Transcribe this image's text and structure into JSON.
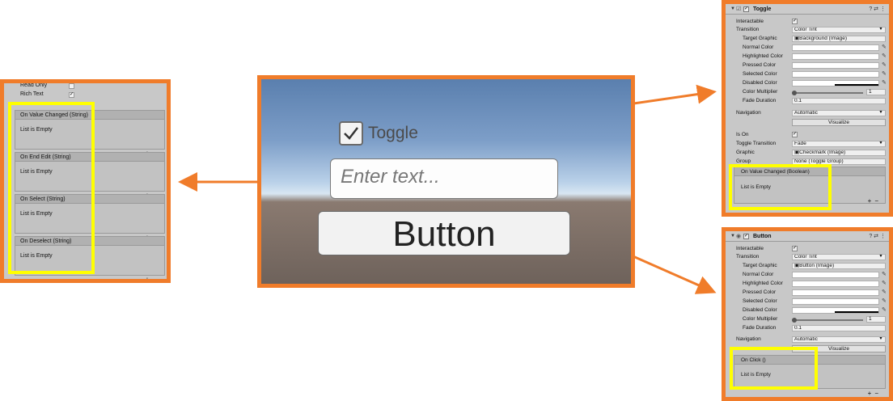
{
  "colors": {
    "accent_frame": "#f07c2a",
    "highlight": "#ffff00",
    "panel_bg": "#c8c8c8"
  },
  "left_panel": {
    "partial_rows": [
      {
        "label": "Read Only",
        "checked": false
      },
      {
        "label": "Rich Text",
        "checked": true
      }
    ],
    "events": [
      {
        "title": "On Value Changed (String)",
        "body": "List is Empty"
      },
      {
        "title": "On End Edit (String)",
        "body": "List is Empty"
      },
      {
        "title": "On Select (String)",
        "body": "List is Empty"
      },
      {
        "title": "On Deselect (String)",
        "body": "List is Empty"
      }
    ],
    "plus": "+",
    "minus": "−"
  },
  "scene": {
    "toggle_label": "Toggle",
    "toggle_checked": true,
    "input_placeholder": "Enter text...",
    "button_label": "Button"
  },
  "toggle_inspector": {
    "title": "Toggle",
    "header_icons": "? ⇄ ⋮",
    "interactable_label": "Interactable",
    "transition_label": "Transition",
    "transition_value": "Color Tint",
    "target_graphic_label": "Target Graphic",
    "target_graphic_value": "Background (Image)",
    "normal_color_label": "Normal Color",
    "highlighted_color_label": "Highlighted Color",
    "pressed_color_label": "Pressed Color",
    "selected_color_label": "Selected Color",
    "disabled_color_label": "Disabled Color",
    "color_multiplier_label": "Color Multiplier",
    "color_multiplier_value": "1",
    "fade_duration_label": "Fade Duration",
    "fade_duration_value": "0.1",
    "navigation_label": "Navigation",
    "navigation_value": "Automatic",
    "visualize_label": "Visualize",
    "is_on_label": "Is On",
    "toggle_transition_label": "Toggle Transition",
    "toggle_transition_value": "Fade",
    "graphic_label": "Graphic",
    "graphic_value": "Checkmark (Image)",
    "group_label": "Group",
    "group_value": "None (Toggle Group)",
    "event_title": "On Value Changed (Boolean)",
    "event_body": "List is Empty",
    "plus": "+",
    "minus": "−"
  },
  "button_inspector": {
    "title": "Button",
    "header_icons": "? ⇄ ⋮",
    "interactable_label": "Interactable",
    "transition_label": "Transition",
    "transition_value": "Color Tint",
    "target_graphic_label": "Target Graphic",
    "target_graphic_value": "Button (Image)",
    "normal_color_label": "Normal Color",
    "highlighted_color_label": "Highlighted Color",
    "pressed_color_label": "Pressed Color",
    "selected_color_label": "Selected Color",
    "disabled_color_label": "Disabled Color",
    "color_multiplier_label": "Color Multiplier",
    "color_multiplier_value": "1",
    "fade_duration_label": "Fade Duration",
    "fade_duration_value": "0.1",
    "navigation_label": "Navigation",
    "navigation_value": "Automatic",
    "visualize_label": "Visualize",
    "event_title": "On Click ()",
    "event_body": "List is Empty",
    "plus": "+",
    "minus": "−"
  }
}
